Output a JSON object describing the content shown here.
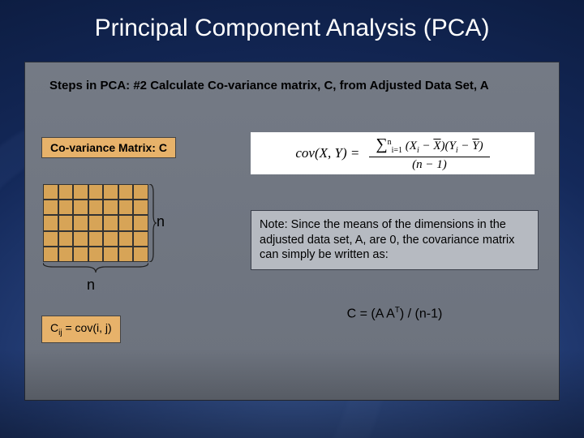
{
  "title": "Principal Component Analysis (PCA)",
  "step_line": "Steps in PCA: #2 Calculate Co-variance matrix, C, from Adjusted Data Set, A",
  "cov_matrix_label": "Co-variance Matrix: C",
  "matrix": {
    "n_right": "n",
    "n_bottom": "n"
  },
  "cij": {
    "prefix": "C",
    "sub": "ij",
    "rest": " = cov(i, j)"
  },
  "cov_formula": {
    "lhs": "cov(X, Y) =",
    "sum_lo": "i=1",
    "sum_hi": "n",
    "term_open": "(X",
    "term_Xi_sub": "i",
    "minus": " − ",
    "Xbar": "X",
    "term_mid": ")(Y",
    "term_Yi_sub": "i",
    "Ybar": "Y",
    "term_close": ")",
    "den_open": "(n − 1)"
  },
  "note": "Note: Since the means of the dimensions in the adjusted data set, A, are 0, the covariance matrix can simply be written as:",
  "simplified": {
    "lhs": "C =  (A A",
    "sup": "T",
    "rhs": ") / (n-1)"
  }
}
